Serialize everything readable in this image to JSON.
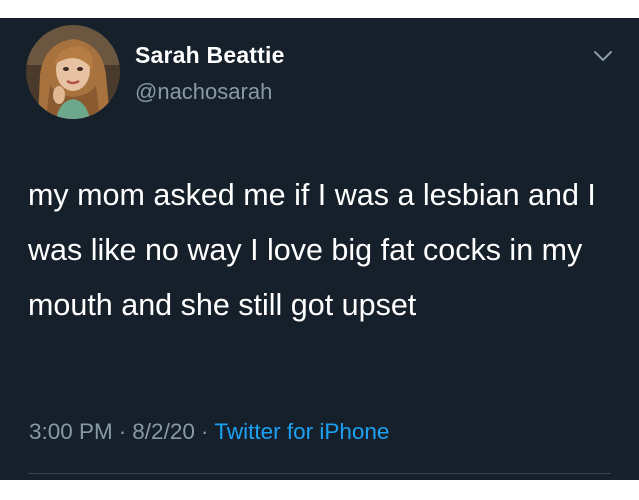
{
  "tweet": {
    "display_name": "Sarah Beattie",
    "handle": "@nachosarah",
    "text": "my mom asked me if I was a lesbian and I was like no way I love big fat cocks in my mouth and she still got upset",
    "time": "3:00 PM",
    "date": "8/2/20",
    "separator": "·",
    "source": "Twitter for iPhone"
  },
  "icons": {
    "menu": "chevron-down-icon",
    "avatar": "profile-photo"
  },
  "colors": {
    "background": "#15202b",
    "text": "#ffffff",
    "secondary_text": "#8899a6",
    "link": "#1da1f2"
  }
}
